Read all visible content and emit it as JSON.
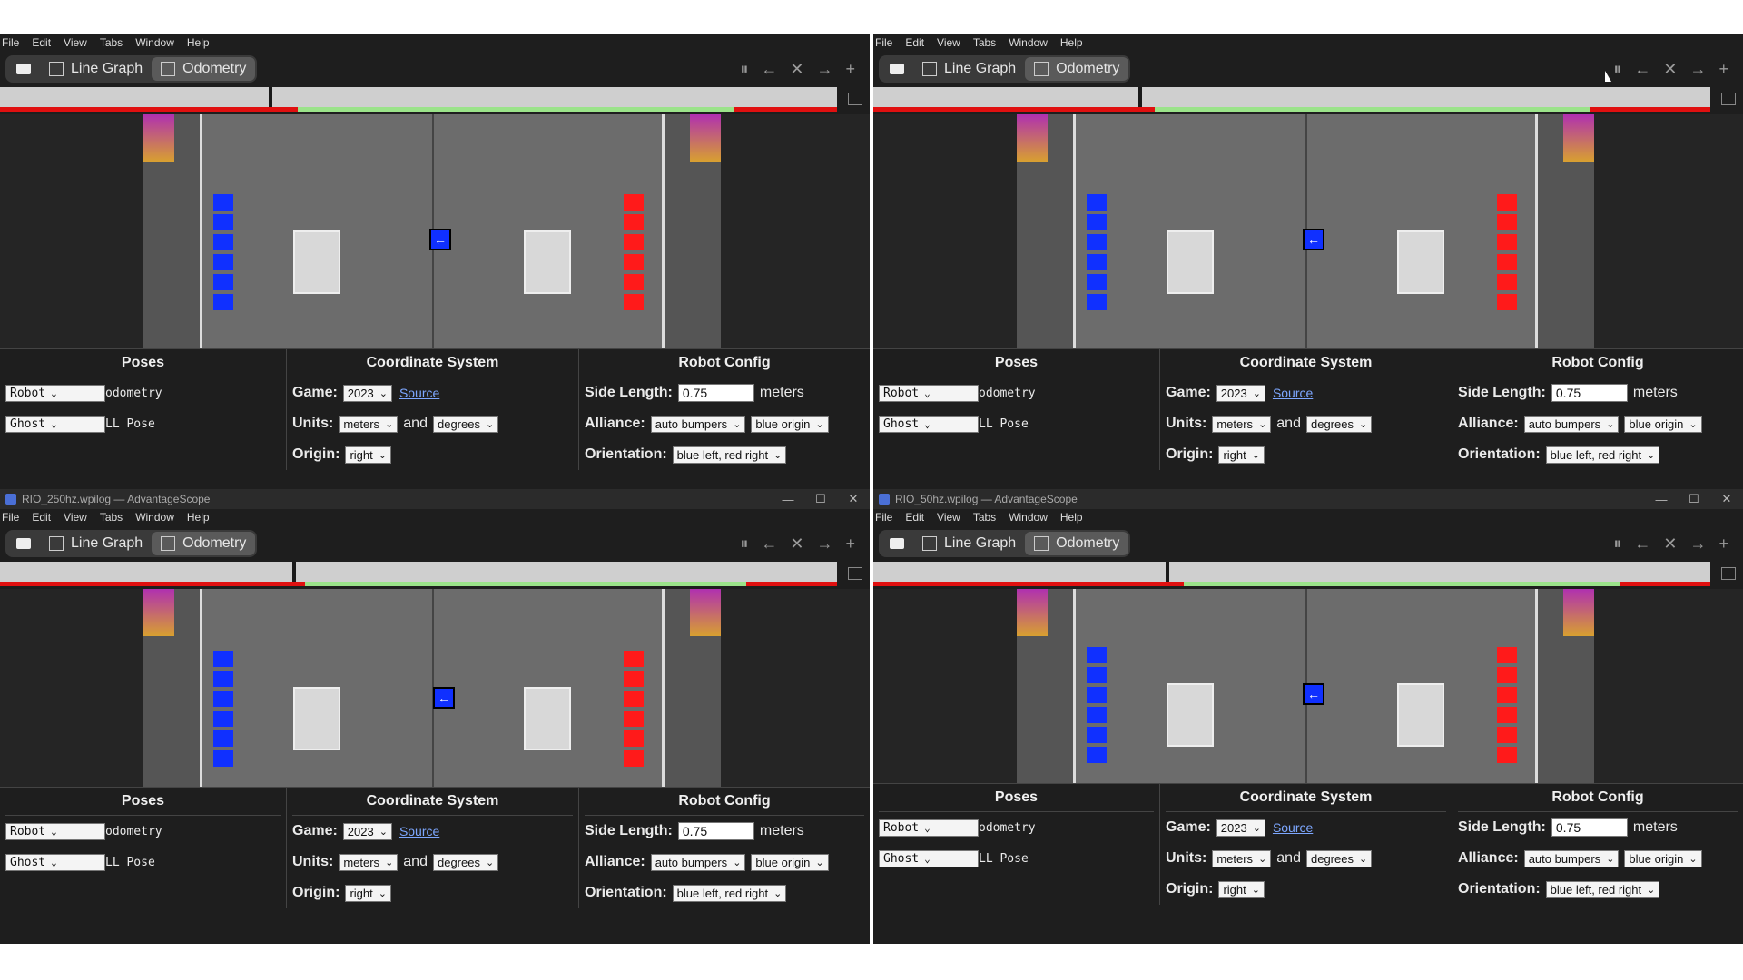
{
  "windows": [
    {
      "title": "",
      "show_titlebar": false
    },
    {
      "title": "",
      "show_titlebar": false
    },
    {
      "title": "RIO_250hz.wpilog — AdvantageScope",
      "show_titlebar": true
    },
    {
      "title": "RIO_50hz.wpilog — AdvantageScope",
      "show_titlebar": true
    }
  ],
  "menu": [
    "File",
    "Edit",
    "View",
    "Tabs",
    "Window",
    "Help"
  ],
  "tabs": {
    "line_graph": "Line Graph",
    "odometry": "Odometry"
  },
  "tab_controls": {
    "pause": "⏸",
    "back": "←",
    "close": "✕",
    "forward": "→",
    "add": "+"
  },
  "config": {
    "poses_title": "Poses",
    "coord_title": "Coordinate System",
    "robot_title": "Robot Config",
    "pose1_type": "Robot",
    "pose1_name": "odometry",
    "pose2_type": "Ghost",
    "pose2_name": "LL Pose",
    "game_label": "Game:",
    "game_value": "2023",
    "source_link": "Source",
    "units_label": "Units:",
    "units_distance": "meters",
    "units_and": "and",
    "units_angle": "degrees",
    "origin_label": "Origin:",
    "origin_value": "right",
    "side_length_label": "Side Length:",
    "side_length_value": "0.75",
    "side_length_unit": "meters",
    "alliance_label": "Alliance:",
    "alliance_bumpers": "auto bumpers",
    "alliance_origin": "blue origin",
    "orientation_label": "Orientation:",
    "orientation_value": "blue left, red right"
  },
  "robot_glyph": "←",
  "colors": {
    "blue_alliance": "#1030ff",
    "red_alliance": "#ff1a1a",
    "timeline_red": "#e01010",
    "timeline_green": "#9be38a"
  }
}
